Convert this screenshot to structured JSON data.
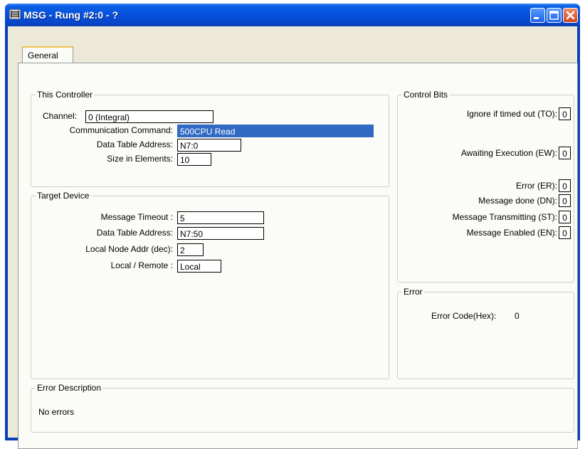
{
  "window": {
    "title": "MSG - Rung #2:0 - ?"
  },
  "tabs": [
    {
      "label": "General"
    }
  ],
  "this_controller": {
    "title": "This Controller",
    "channel_label": "Channel:",
    "channel_value": "0 (Integral)",
    "command_label": "Communication Command:",
    "command_value": "500CPU Read",
    "address_label": "Data Table Address:",
    "address_value": "N7:0",
    "size_label": "Size in Elements:",
    "size_value": "10"
  },
  "target_device": {
    "title": "Target Device",
    "timeout_label": "Message Timeout :",
    "timeout_value": "5",
    "address_label": "Data Table Address:",
    "address_value": "N7:50",
    "node_label": "Local Node Addr (dec):",
    "node_value": "2",
    "remote_label": "Local / Remote :",
    "remote_value": "Local"
  },
  "control_bits": {
    "title": "Control Bits",
    "bits": [
      {
        "label": "Ignore if timed out (TO):",
        "value": "0"
      },
      {
        "label": "Awaiting Execution (EW):",
        "value": "0"
      },
      {
        "label": "Error (ER):",
        "value": "0"
      },
      {
        "label": "Message done (DN):",
        "value": "0"
      },
      {
        "label": "Message Transmitting (ST):",
        "value": "0"
      },
      {
        "label": "Message Enabled (EN):",
        "value": "0"
      }
    ]
  },
  "error": {
    "title": "Error",
    "code_label": "Error Code(Hex):",
    "code_value": "0"
  },
  "error_description": {
    "title": "Error Description",
    "text": "No errors"
  },
  "icons": [
    "msg-window-icon",
    "minimize-icon",
    "maximize-icon",
    "close-icon"
  ],
  "colors": {
    "titlebar": "#0651dc",
    "selection": "#316ac5",
    "face": "#ece9d8",
    "tab_highlight": "#f4c14c"
  }
}
